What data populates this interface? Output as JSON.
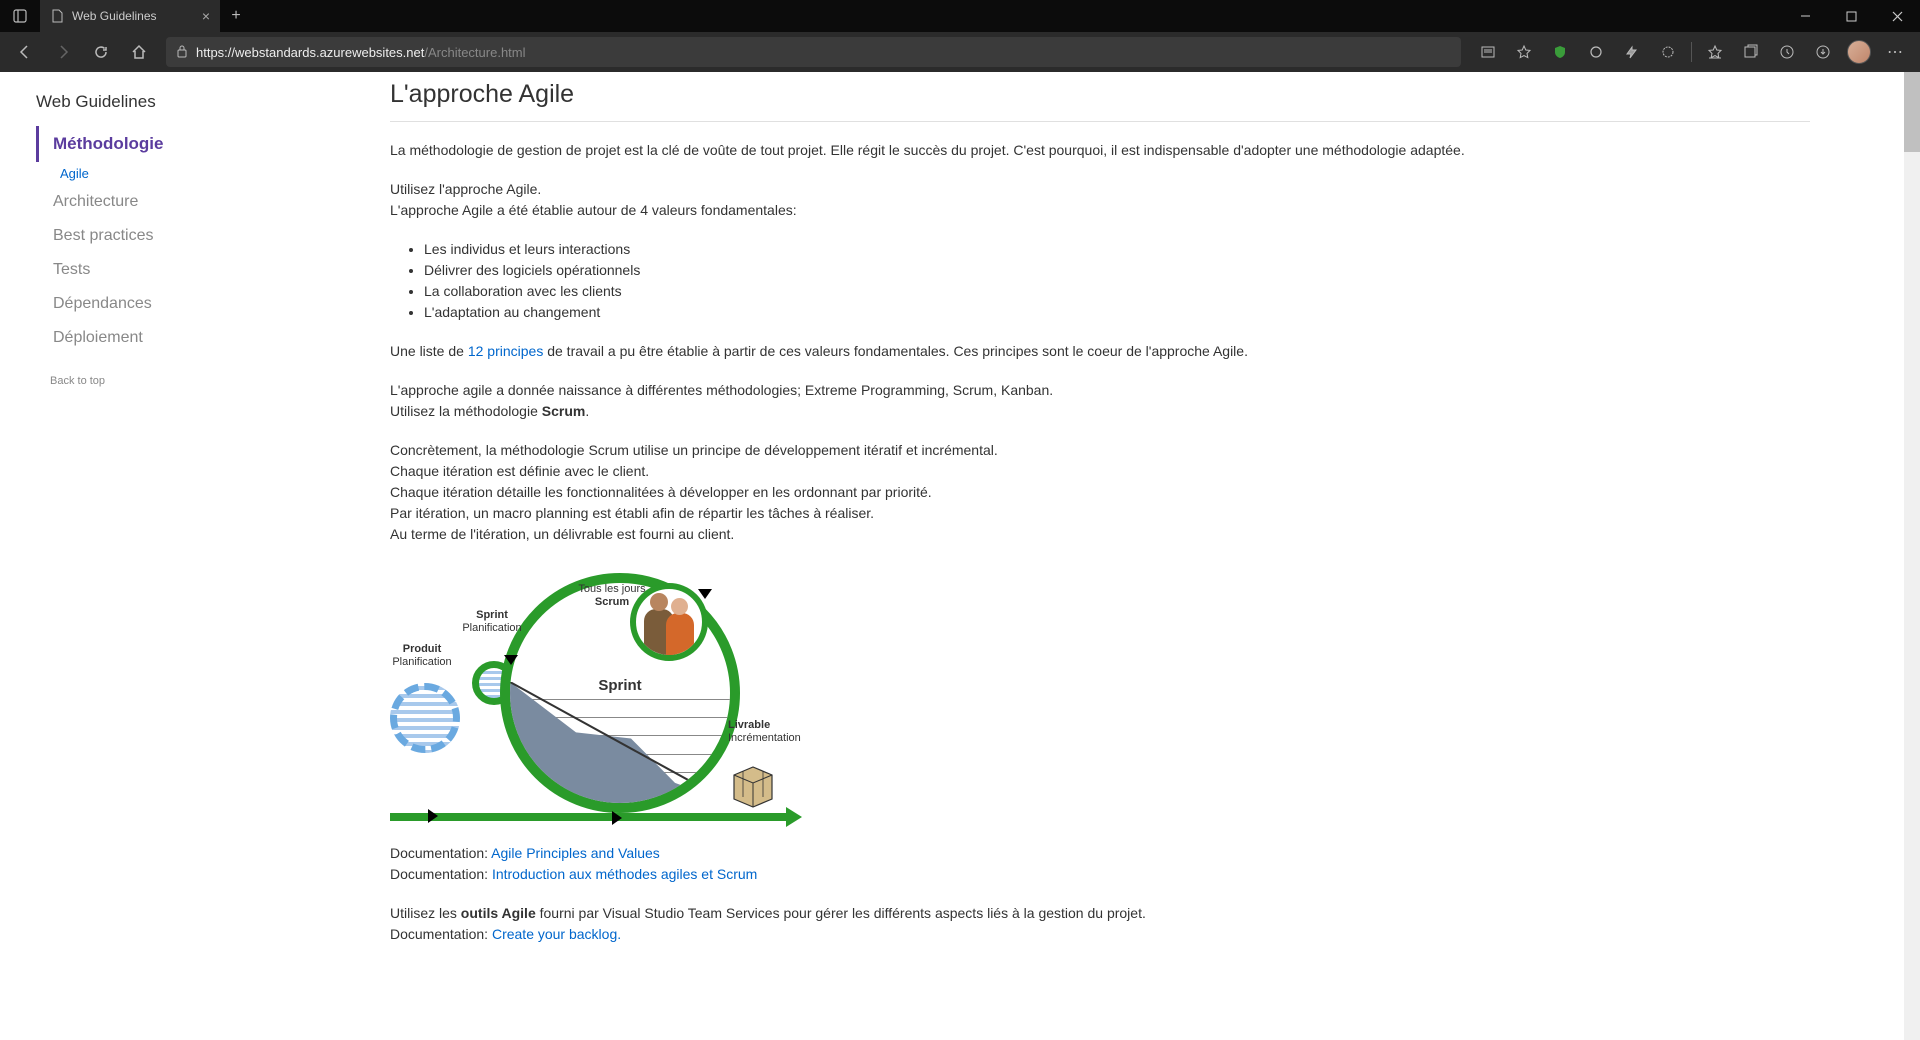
{
  "browser": {
    "tab_title": "Web Guidelines",
    "url_host": "https://webstandards.azurewebsites.net",
    "url_path": "/Architecture.html"
  },
  "sidebar": {
    "title": "Web Guidelines",
    "items": [
      {
        "label": "Méthodologie",
        "active": true
      },
      {
        "label": "Architecture",
        "active": false
      },
      {
        "label": "Best practices",
        "active": false
      },
      {
        "label": "Tests",
        "active": false
      },
      {
        "label": "Dépendances",
        "active": false
      },
      {
        "label": "Déploiement",
        "active": false
      }
    ],
    "sub_item": "Agile",
    "back_to_top": "Back to top"
  },
  "content": {
    "heading": "L'approche Agile",
    "intro": "La méthodologie de gestion de projet est la clé de voûte de tout projet. Elle régit le succès du projet. C'est pourquoi, il est indispensable d'adopter une méthodologie adaptée.",
    "use_agile_line1": "Utilisez l'approche Agile.",
    "use_agile_line2": "L'approche Agile a été établie autour de 4 valeurs fondamentales:",
    "values": [
      "Les individus et leurs interactions",
      "Délivrer des logiciels opérationnels",
      "La collaboration avec les clients",
      "L'adaptation au changement"
    ],
    "principles_before": "Une liste de ",
    "principles_link": "12 principes",
    "principles_after": " de travail a pu être établie à partir de ces valeurs fondamentales. Ces principes sont le coeur de l'approche Agile.",
    "methodologies_line1": "L'approche agile a donnée naissance à différentes méthodologies; Extreme Programming, Scrum, Kanban.",
    "methodologies_line2_before": "Utilisez la méthodologie ",
    "scrum_bold": "Scrum",
    "scrum_desc_1": "Concrètement, la méthodologie Scrum utilise un principe de développement itératif et incrémental.",
    "scrum_desc_2": "Chaque itération est définie avec le client.",
    "scrum_desc_3": "Chaque itération détaille les fonctionnalitées à développer en les ordonnant par priorité.",
    "scrum_desc_4": "Par itération, un macro planning est établi afin de répartir les tâches à réaliser.",
    "scrum_desc_5": "Au terme de l'itération, un délivrable est fourni au client.",
    "diagram": {
      "daily_top": "Tous les jours",
      "daily_bold": "Scrum",
      "sprint_plan_bold": "Sprint",
      "sprint_plan": "Planification",
      "product_plan_bold": "Produit",
      "product_plan": "Planification",
      "sprint_center": "Sprint",
      "deliverable_bold": "Livrable",
      "deliverable": "Incrémentation"
    },
    "doc_label": "Documentation: ",
    "doc1_link": "Agile Principles and Values",
    "doc2_link": "Introduction aux méthodes agiles et Scrum",
    "outils_before": "Utilisez les ",
    "outils_bold": "outils Agile",
    "outils_after": " fourni par Visual Studio Team Services pour gérer les différents aspects liés à la gestion du projet.",
    "doc3_link": "Create your backlog."
  }
}
